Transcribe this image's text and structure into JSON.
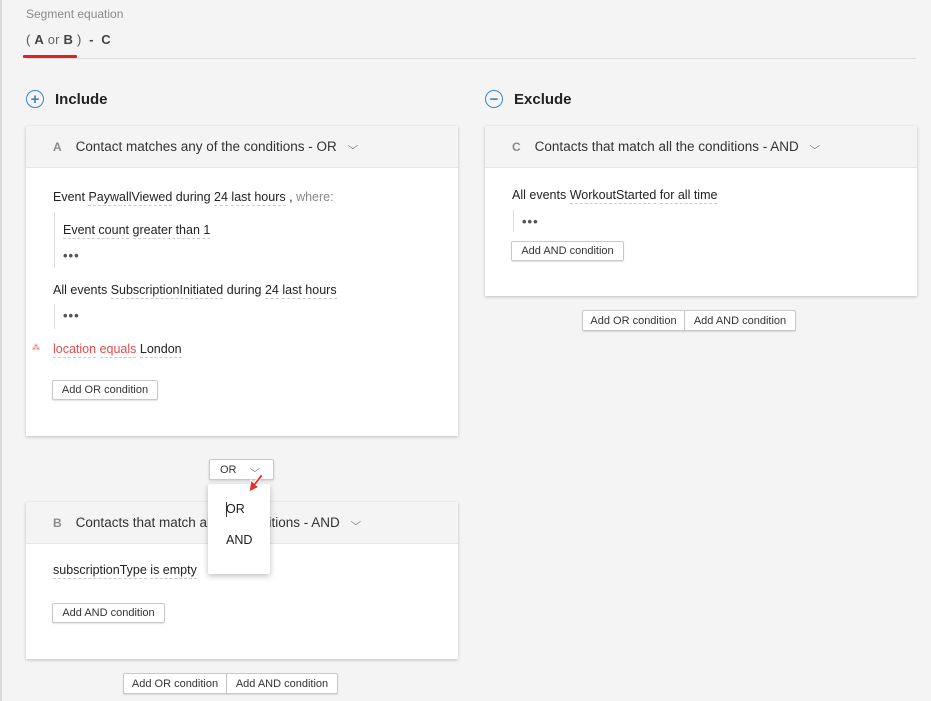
{
  "equation": {
    "label": "Segment equation",
    "open_paren": "(",
    "a": "A",
    "or": "or",
    "b": "B",
    "close_paren": ")",
    "minus": "-",
    "c": "C"
  },
  "include": {
    "title": "Include",
    "icon": "plus-circle-icon",
    "cards": {
      "a": {
        "letter": "A",
        "title": "Contact matches any of the conditions - OR",
        "cond1": {
          "prefix": "Event",
          "event": "PaywallViewed",
          "during": "during",
          "count": "24",
          "unit": "last hours",
          "comma": ",",
          "where": "where:",
          "sub": {
            "field": "Event count",
            "op": "greater than",
            "value": "1"
          },
          "more": "•••"
        },
        "cond2": {
          "prefix": "All events",
          "event": "SubscriptionInitiated",
          "during": "during",
          "count": "24",
          "unit": "last hours",
          "more": "•••"
        },
        "cond3": {
          "error_icon": "broken-link-icon",
          "error_mark": "⁂",
          "field": "location",
          "op": "equals",
          "value": "London"
        },
        "add_button": "Add OR condition"
      },
      "b": {
        "letter": "B",
        "title": "Contacts that match all the conditions - AND",
        "cond1": {
          "field": "subscriptionType",
          "op": "is empty"
        },
        "add_button": "Add AND condition"
      }
    },
    "operator": {
      "value": "OR",
      "options": [
        "OR",
        "AND"
      ]
    },
    "footer": {
      "or": "Add OR condition",
      "and": "Add AND condition"
    }
  },
  "exclude": {
    "title": "Exclude",
    "icon": "minus-circle-icon",
    "card": {
      "letter": "C",
      "title": "Contacts that match all the conditions - AND",
      "cond1": {
        "prefix": "All events",
        "event": "WorkoutStarted",
        "period": "for all time",
        "more": "•••"
      },
      "add_button": "Add AND condition"
    },
    "footer": {
      "or": "Add OR condition",
      "and": "Add AND condition"
    }
  },
  "colors": {
    "accent": "#3d86c6",
    "error": "#e24b4b",
    "underline": "#e02020"
  }
}
